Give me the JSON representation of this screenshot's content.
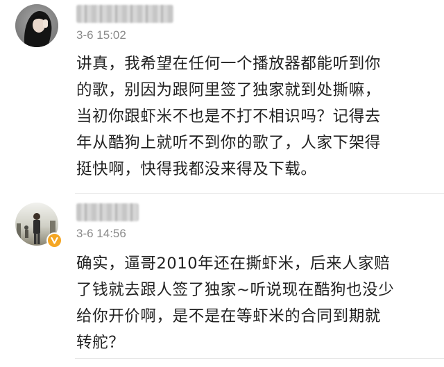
{
  "comments": [
    {
      "timestamp": "3-6 15:02",
      "lines": [
        "讲真，我希望在任何一个播放器都能听到你",
        "的歌，别因为跟阿里签了独家就到处撕嘛，",
        "当初你跟虾米不也是不打不相识吗？记得去",
        "年从酷狗上就听不到你的歌了，人家下架得",
        "挺快啊，快得我都没来得及下载。"
      ]
    },
    {
      "timestamp": "3-6 14:56",
      "verified": true,
      "lines": [
        "确实，逼哥2010年还在撕虾米，后来人家赔",
        "了钱就去跟人签了独家~听说现在酷狗也没少",
        "给你开价啊，是不是在等虾米的合同到期就",
        "转舵？"
      ]
    }
  ],
  "colors": {
    "text": "#222222",
    "timestamp": "#8a8a8a",
    "divider": "#e3e3e3",
    "verified_badge": "#f5a623"
  },
  "icons": {
    "verified": "verified-v-icon"
  }
}
